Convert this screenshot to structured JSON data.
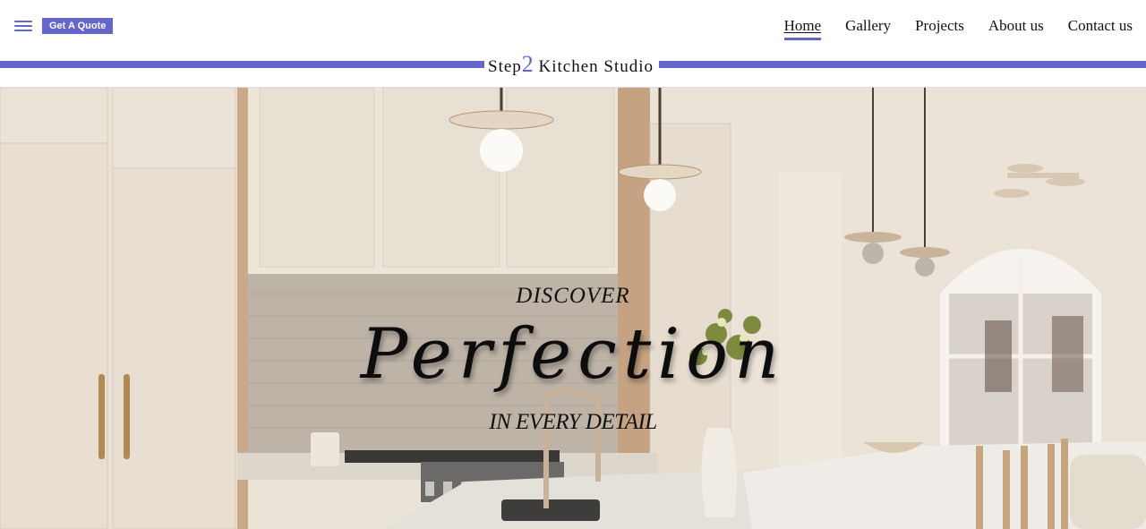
{
  "header": {
    "menu_icon": "hamburger-menu-icon",
    "quote_button": "Get A Quote",
    "accent_color": "#6566c9",
    "nav": [
      {
        "label": "Home",
        "active": true
      },
      {
        "label": "Gallery",
        "active": false
      },
      {
        "label": "Projects",
        "active": false
      },
      {
        "label": "About us",
        "active": false
      },
      {
        "label": "Contact us",
        "active": false
      }
    ]
  },
  "brand": {
    "prefix": "Step",
    "number": "2",
    "suffix": " Kitchen Studio"
  },
  "hero": {
    "image": "kitchen-interior-photo",
    "line1": "DISCOVER",
    "line2": "Perfection",
    "line3": "IN EVERY DETAIL"
  }
}
